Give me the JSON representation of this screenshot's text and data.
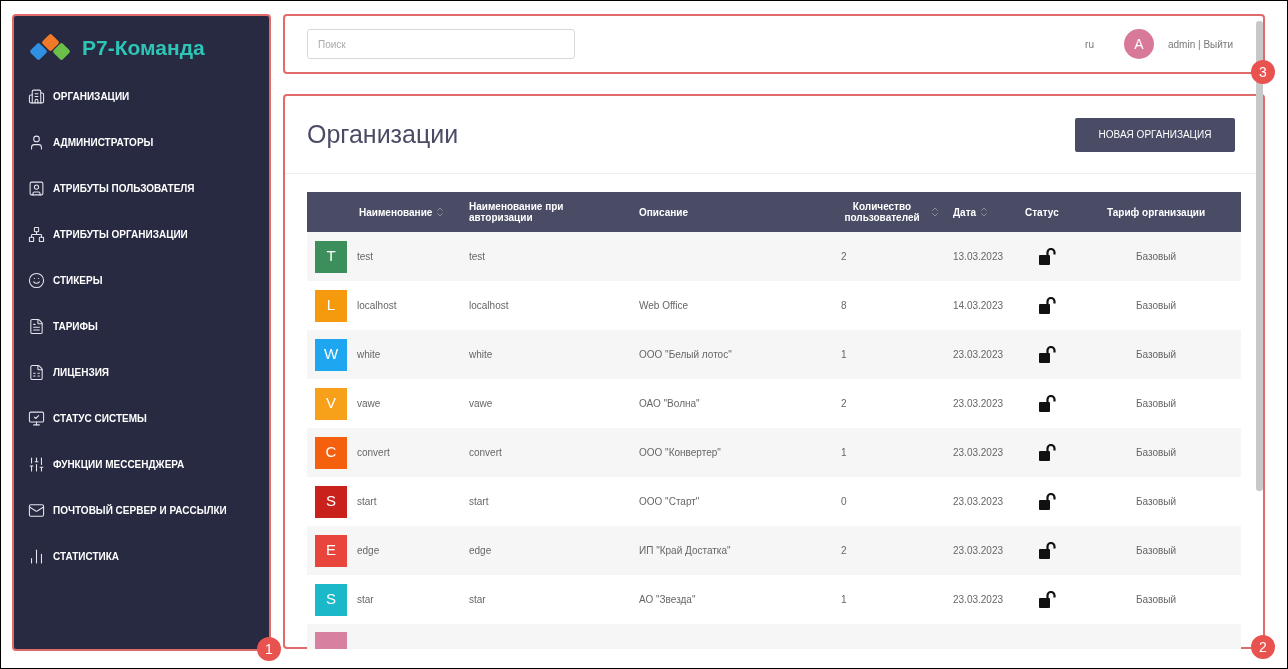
{
  "sidebar": {
    "logo": "Р7-Команда",
    "callout": "1",
    "items": [
      {
        "label": "ОРГАНИЗАЦИИ"
      },
      {
        "label": "АДМИНИСТРАТОРЫ"
      },
      {
        "label": "АТРИБУТЫ ПОЛЬЗОВАТЕЛЯ"
      },
      {
        "label": "АТРИБУТЫ ОРГАНИЗАЦИИ"
      },
      {
        "label": "СТИКЕРЫ"
      },
      {
        "label": "ТАРИФЫ"
      },
      {
        "label": "ЛИЦЕНЗИЯ"
      },
      {
        "label": "СТАТУС СИСТЕМЫ"
      },
      {
        "label": "ФУНКЦИИ МЕССЕНДЖЕРА"
      },
      {
        "label": "ПОЧТОВЫЙ СЕРВЕР И РАССЫЛКИ"
      },
      {
        "label": "СТАТИСТИКА"
      }
    ]
  },
  "header": {
    "callout": "3",
    "search": {
      "placeholder": "Поиск"
    },
    "language": "ru",
    "avatar": "A",
    "user": "admin | Выйти"
  },
  "content": {
    "callout": "2",
    "title": "Организации",
    "new_button": "НОВАЯ ОРГАНИЗАЦИЯ",
    "table": {
      "columns": [
        {
          "label": "Наименование",
          "sortable": true
        },
        {
          "label": "Наименование при авторизации",
          "sortable": false
        },
        {
          "label": "Описание",
          "sortable": false
        },
        {
          "label": "Количество пользователей",
          "sortable": true
        },
        {
          "label": "Дата",
          "sortable": true
        },
        {
          "label": "Статус",
          "sortable": false
        },
        {
          "label": "Тариф организации",
          "sortable": false
        }
      ],
      "rows": [
        {
          "letter": "T",
          "color": "#3c8f5a",
          "name": "test",
          "login": "test",
          "description": "",
          "users": "2",
          "date": "13.03.2023",
          "locked": false,
          "tariff": "Базовый"
        },
        {
          "letter": "L",
          "color": "#f59a0c",
          "name": "localhost",
          "login": "localhost",
          "description": "Web Office",
          "users": "8",
          "date": "14.03.2023",
          "locked": false,
          "tariff": "Базовый"
        },
        {
          "letter": "W",
          "color": "#1ea7f0",
          "name": "white",
          "login": "white",
          "description": "ООО \"Белый лотос\"",
          "users": "1",
          "date": "23.03.2023",
          "locked": false,
          "tariff": "Базовый"
        },
        {
          "letter": "V",
          "color": "#f7a11a",
          "name": "vawe",
          "login": "vawe",
          "description": "ОАО \"Волна\"",
          "users": "2",
          "date": "23.03.2023",
          "locked": false,
          "tariff": "Базовый"
        },
        {
          "letter": "C",
          "color": "#f4600e",
          "name": "convert",
          "login": "convert",
          "description": "ООО \"Конвертер\"",
          "users": "1",
          "date": "23.03.2023",
          "locked": false,
          "tariff": "Базовый"
        },
        {
          "letter": "S",
          "color": "#c9211c",
          "name": "start",
          "login": "start",
          "description": "ООО \"Старт\"",
          "users": "0",
          "date": "23.03.2023",
          "locked": false,
          "tariff": "Базовый"
        },
        {
          "letter": "E",
          "color": "#e8453c",
          "name": "edge",
          "login": "edge",
          "description": "ИП \"Край Достатка\"",
          "users": "2",
          "date": "23.03.2023",
          "locked": false,
          "tariff": "Базовый"
        },
        {
          "letter": "S",
          "color": "#1ab8c8",
          "name": "star",
          "login": "star",
          "description": "АО \"Звезда\"",
          "users": "1",
          "date": "23.03.2023",
          "locked": false,
          "tariff": "Базовый"
        }
      ],
      "partial_row": {
        "color": "#d7809f"
      }
    }
  }
}
